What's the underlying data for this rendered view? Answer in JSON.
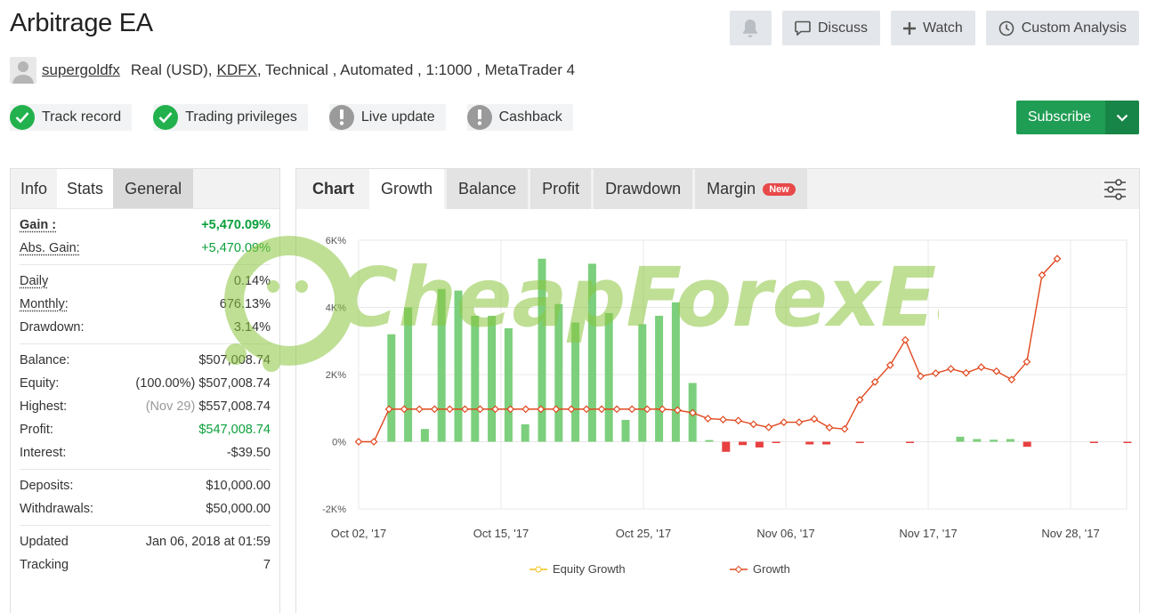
{
  "header": {
    "title": "Arbitrage EA",
    "discuss_label": "Discuss",
    "watch_label": "Watch",
    "custom_analysis_label": "Custom Analysis"
  },
  "meta": {
    "username": "supergoldfx",
    "account_type": "Real (USD),",
    "broker": "KDFX",
    "details": ", Technical , Automated , 1:1000 , MetaTrader 4"
  },
  "badges": [
    {
      "label": "Track record",
      "status": "ok"
    },
    {
      "label": "Trading privileges",
      "status": "ok"
    },
    {
      "label": "Live update",
      "status": "warn"
    },
    {
      "label": "Cashback",
      "status": "warn"
    }
  ],
  "subscribe_label": "Subscribe",
  "left_tabs": {
    "info": "Info",
    "stats": "Stats",
    "general": "General"
  },
  "stats": {
    "gain_label": "Gain :",
    "gain_value": "+5,470.09%",
    "abs_gain_label": "Abs. Gain:",
    "abs_gain_value": "+5,470.09%",
    "daily_label": "Daily",
    "daily_value": "0.14%",
    "monthly_label": "Monthly:",
    "monthly_value": "676.13%",
    "drawdown_label": "Drawdown:",
    "drawdown_value": "3.14%",
    "balance_label": "Balance:",
    "balance_value": "$507,008.74",
    "equity_label": "Equity:",
    "equity_value": "(100.00%) $507,008.74",
    "highest_label": "Highest:",
    "highest_date": "(Nov 29)",
    "highest_value": "$557,008.74",
    "profit_label": "Profit:",
    "profit_value": "$547,008.74",
    "interest_label": "Interest:",
    "interest_value": "-$39.50",
    "deposits_label": "Deposits:",
    "deposits_value": "$10,000.00",
    "withdrawals_label": "Withdrawals:",
    "withdrawals_value": "$50,000.00",
    "updated_label": "Updated",
    "updated_value": "Jan 06, 2018 at 01:59",
    "tracking_label": "Tracking",
    "tracking_value": "7"
  },
  "chart_tabs": {
    "chart": "Chart",
    "growth": "Growth",
    "balance": "Balance",
    "profit": "Profit",
    "drawdown": "Drawdown",
    "margin": "Margin",
    "new_badge": "New"
  },
  "watermark_text": "CheapForexEa",
  "colors": {
    "green": "#1f9d55",
    "growth_line": "#e0471d",
    "bar_pos": "#7ccf7c",
    "bar_neg": "#e84040",
    "equity_line": "#f2c21b"
  },
  "chart_data": {
    "type": "bar",
    "y_ticks": [
      "6K%",
      "4K%",
      "2K%",
      "0%",
      "-2K%"
    ],
    "y_tick_values": [
      6000,
      4000,
      2000,
      0,
      -2000
    ],
    "ylim": [
      -2000,
      6000
    ],
    "x_ticks": [
      "Oct 02, '17",
      "Oct 15, '17",
      "Oct 25, '17",
      "Nov 06, '17",
      "Nov 17, '17",
      "Nov 28, '17"
    ],
    "x_tick_index": [
      0,
      9,
      18,
      27,
      36,
      45
    ],
    "legend": [
      "Equity Growth",
      "Growth"
    ],
    "bars": [
      0,
      3200,
      4000,
      380,
      4550,
      4500,
      3750,
      3750,
      3380,
      520,
      5450,
      4100,
      3550,
      5300,
      3830,
      650,
      3500,
      3750,
      4150,
      1750,
      50,
      -300,
      -100,
      -170,
      -20,
      0,
      -80,
      -80,
      0,
      -30,
      0,
      0,
      -10,
      0,
      0,
      150,
      80,
      60,
      80,
      -150,
      0,
      0,
      0,
      -20,
      0,
      -20,
      50,
      200,
      50
    ],
    "growth": [
      0,
      0,
      970,
      970,
      970,
      970,
      970,
      970,
      970,
      970,
      970,
      970,
      970,
      970,
      970,
      970,
      970,
      970,
      970,
      970,
      970,
      940,
      860,
      690,
      660,
      630,
      520,
      430,
      580,
      580,
      680,
      420,
      380,
      1250,
      1780,
      2280,
      3030,
      1950,
      2040,
      2170,
      2050,
      2220,
      2100,
      1850,
      2380,
      4960,
      5450
    ],
    "growth_x": [
      0,
      1,
      2,
      3,
      4,
      5,
      6,
      7,
      8,
      9,
      10,
      11,
      12,
      13,
      14,
      15,
      16,
      17,
      18,
      19,
      20,
      21,
      22,
      23,
      24,
      25,
      26,
      27,
      28,
      29,
      30,
      31,
      32,
      33,
      34,
      35,
      36,
      37,
      38,
      39,
      40,
      41,
      42,
      43,
      44,
      45,
      46
    ]
  }
}
